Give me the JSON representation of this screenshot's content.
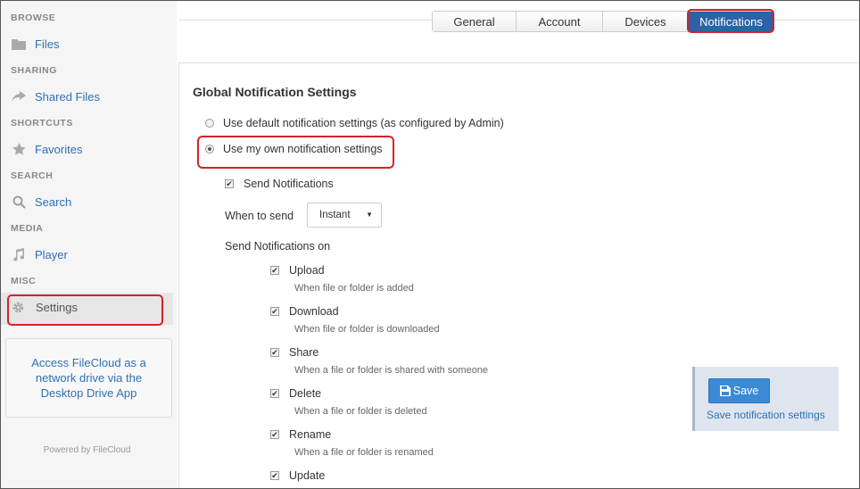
{
  "sidebar": {
    "sections": [
      {
        "label": "BROWSE",
        "item": {
          "label": "Files",
          "icon": "folder-icon"
        }
      },
      {
        "label": "SHARING",
        "item": {
          "label": "Shared Files",
          "icon": "share-arrow-icon"
        }
      },
      {
        "label": "SHORTCUTS",
        "item": {
          "label": "Favorites",
          "icon": "star-icon"
        }
      },
      {
        "label": "SEARCH",
        "item": {
          "label": "Search",
          "icon": "search-icon"
        }
      },
      {
        "label": "MEDIA",
        "item": {
          "label": "Player",
          "icon": "music-note-icon"
        }
      },
      {
        "label": "MISC",
        "item": {
          "label": "Settings",
          "icon": "gear-icon"
        }
      }
    ],
    "promo_text": "Access FileCloud as a network drive via the Desktop Drive App",
    "powered_by": "Powered by FileCloud"
  },
  "tabs": [
    {
      "label": "General",
      "active": false
    },
    {
      "label": "Account",
      "active": false
    },
    {
      "label": "Devices",
      "active": false
    },
    {
      "label": "Notifications",
      "active": true
    }
  ],
  "main": {
    "title": "Global Notification Settings",
    "radio_default": "Use default notification settings (as configured by Admin)",
    "radio_own": "Use my own notification settings",
    "send_notifications": "Send Notifications",
    "when_to_send_label": "When to send",
    "when_to_send_value": "Instant",
    "send_on_label": "Send Notifications on",
    "events": [
      {
        "label": "Upload",
        "desc": "When file or folder is added"
      },
      {
        "label": "Download",
        "desc": "When file or folder is downloaded"
      },
      {
        "label": "Share",
        "desc": "When a file or folder is shared with someone"
      },
      {
        "label": "Delete",
        "desc": "When a file or folder is deleted"
      },
      {
        "label": "Rename",
        "desc": "When a file or folder is renamed"
      },
      {
        "label": "Update",
        "desc": ""
      }
    ]
  },
  "save": {
    "button_label": "Save",
    "hint": "Save notification settings"
  },
  "colors": {
    "accent": "#2b63a6",
    "highlight": "#d9202a",
    "link": "#2f70b5"
  }
}
